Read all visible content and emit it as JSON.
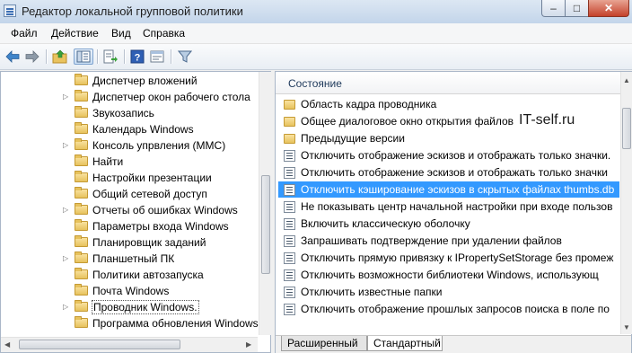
{
  "window": {
    "title": "Редактор локальной групповой политики",
    "controls": {
      "minimize": "–",
      "maximize": "□",
      "close": "✕"
    }
  },
  "menu": [
    "Файл",
    "Действие",
    "Вид",
    "Справка"
  ],
  "toolbar": {
    "icons": [
      "back-arrow-icon",
      "forward-arrow-icon",
      "up-folder-icon",
      "show-hide-tree-icon",
      "export-list-icon",
      "help-icon",
      "properties-icon",
      "filter-icon"
    ],
    "help_glyph": "?"
  },
  "tree": {
    "items": [
      {
        "label": "Диспетчер вложений",
        "expandable": false
      },
      {
        "label": "Диспетчер окон рабочего стола",
        "expandable": true
      },
      {
        "label": "Звукозапись",
        "expandable": false
      },
      {
        "label": "Календарь Windows",
        "expandable": false
      },
      {
        "label": "Консоль упрвления (MMC)",
        "expandable": true
      },
      {
        "label": "Найти",
        "expandable": false
      },
      {
        "label": "Настройки презентации",
        "expandable": false
      },
      {
        "label": "Общий сетевой доступ",
        "expandable": false
      },
      {
        "label": "Отчеты об ошибках Windows",
        "expandable": true
      },
      {
        "label": "Параметры входа Windows",
        "expandable": false
      },
      {
        "label": "Планировщик заданий",
        "expandable": false
      },
      {
        "label": "Планшетный ПК",
        "expandable": true
      },
      {
        "label": "Политики автозапуска",
        "expandable": false
      },
      {
        "label": "Почта Windows",
        "expandable": false
      },
      {
        "label": "Проводник Windows.",
        "expandable": true,
        "selected": true
      },
      {
        "label": "Программа обновления Windows",
        "expandable": false
      }
    ]
  },
  "list": {
    "column_header": "Состояние",
    "rows": [
      {
        "label": "Область кадра проводника",
        "type": "folder"
      },
      {
        "label": "Общее диалоговое окно открытия файлов",
        "type": "folder"
      },
      {
        "label": "Предыдущие версии",
        "type": "folder"
      },
      {
        "label": "Отключить отображение эскизов и отображать только значки.",
        "type": "setting"
      },
      {
        "label": "Отключить отображение эскизов и отображать только значки",
        "type": "setting"
      },
      {
        "label": "Отключить кэширование эскизов в скрытых файлах thumbs.db",
        "type": "setting",
        "selected": true
      },
      {
        "label": "Не показывать центр начальной настройки при входе пользов",
        "type": "setting"
      },
      {
        "label": "Включить классическую оболочку",
        "type": "setting"
      },
      {
        "label": "Запрашивать подтверждение при удалении файлов",
        "type": "setting"
      },
      {
        "label": "Отключить прямую привязку к IPropertySetStorage без промеж",
        "type": "setting"
      },
      {
        "label": "Отключить возможности библиотеки Windows, использующ",
        "type": "setting"
      },
      {
        "label": "Отключить известные папки",
        "type": "setting"
      },
      {
        "label": "Отключить отображение прошлых запросов поиска в поле по",
        "type": "setting"
      }
    ]
  },
  "watermark": "IT-self.ru",
  "tabs": {
    "extended": "Расширенный",
    "standard": "Стандартный",
    "active": "standard"
  },
  "colors": {
    "selection": "#3399ff",
    "title_bar": "#c3d5ea",
    "close_button": "#c4412a"
  }
}
